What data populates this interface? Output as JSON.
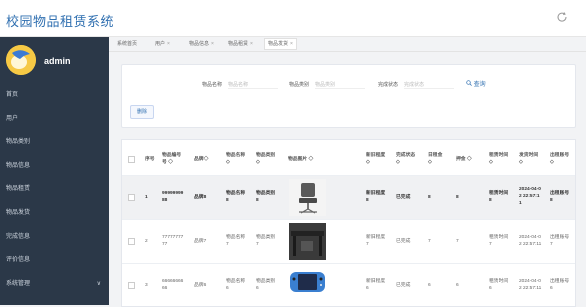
{
  "app": {
    "title": "校园物品租赁系统",
    "username": "admin"
  },
  "sidebar": {
    "items": [
      {
        "label": "首页"
      },
      {
        "label": "用户"
      },
      {
        "label": "物品类别"
      },
      {
        "label": "物品信息"
      },
      {
        "label": "物品租赁"
      },
      {
        "label": "物品发货"
      },
      {
        "label": "完成信息"
      },
      {
        "label": "评价信息"
      },
      {
        "label": "系统管理",
        "expandable": true
      }
    ]
  },
  "tabs": [
    {
      "label": "系统首页",
      "closable": false
    },
    {
      "label": "用户",
      "closable": true
    },
    {
      "label": "物品信息",
      "closable": true
    },
    {
      "label": "物品租赁",
      "closable": true
    },
    {
      "label": "物品发货",
      "closable": true,
      "active": true
    }
  ],
  "search": {
    "name_label": "物品名称",
    "name_placeholder": "物品名称",
    "type_label": "物品类别",
    "type_placeholder": "物品类别",
    "status_label": "完成状态",
    "status_placeholder": "完成状态",
    "search_button": "查询",
    "delete_button": "删除"
  },
  "table": {
    "headers": {
      "index": "序号",
      "item_no": "物品编号\n号 ◇",
      "brand": "品牌◇",
      "name": "物品名称\n◇",
      "type": "物品类别\n◇",
      "image": "物品图片 ◇",
      "condition": "新旧程度\n◇",
      "status": "完成状态\n◇",
      "rent": "日租金\n◇",
      "deposit": "押金 ◇",
      "rent_time": "租赁时间\n◇",
      "ship_time": "发货时间\n◇",
      "account": "出租账号\n◇"
    },
    "rows": [
      {
        "index": "1",
        "item_no": "99999999\n88",
        "brand": "品牌8",
        "name": "物品名称\n8",
        "type": "物品类别\n8",
        "image": "chair",
        "condition": "新旧程度\n8",
        "status": "已完成",
        "rent": "8",
        "deposit": "8",
        "rent_time": "租赁时间\n8",
        "ship_time": "2024-04-0\n2 22:57:1\n1",
        "account": "出租账号\n8"
      },
      {
        "index": "2",
        "item_no": "77777777\n77",
        "brand": "品牌7",
        "name": "物品名称\n7",
        "type": "物品类别\n7",
        "image": "desk",
        "condition": "新旧程度\n7",
        "status": "已完成",
        "rent": "7",
        "deposit": "7",
        "rent_time": "租赁时间\n7",
        "ship_time": "2024-04-0\n2 22:57:11",
        "account": "出租账号\n7"
      },
      {
        "index": "3",
        "item_no": "66666666\n66",
        "brand": "品牌6",
        "name": "物品名称\n6",
        "type": "物品类别\n6",
        "image": "gameconsole",
        "condition": "新旧程度\n6",
        "status": "已完成",
        "rent": "6",
        "deposit": "6",
        "rent_time": "租赁时间\n6",
        "ship_time": "2024-04-0\n2 22:57:11",
        "account": "出租账号\n6"
      }
    ]
  }
}
